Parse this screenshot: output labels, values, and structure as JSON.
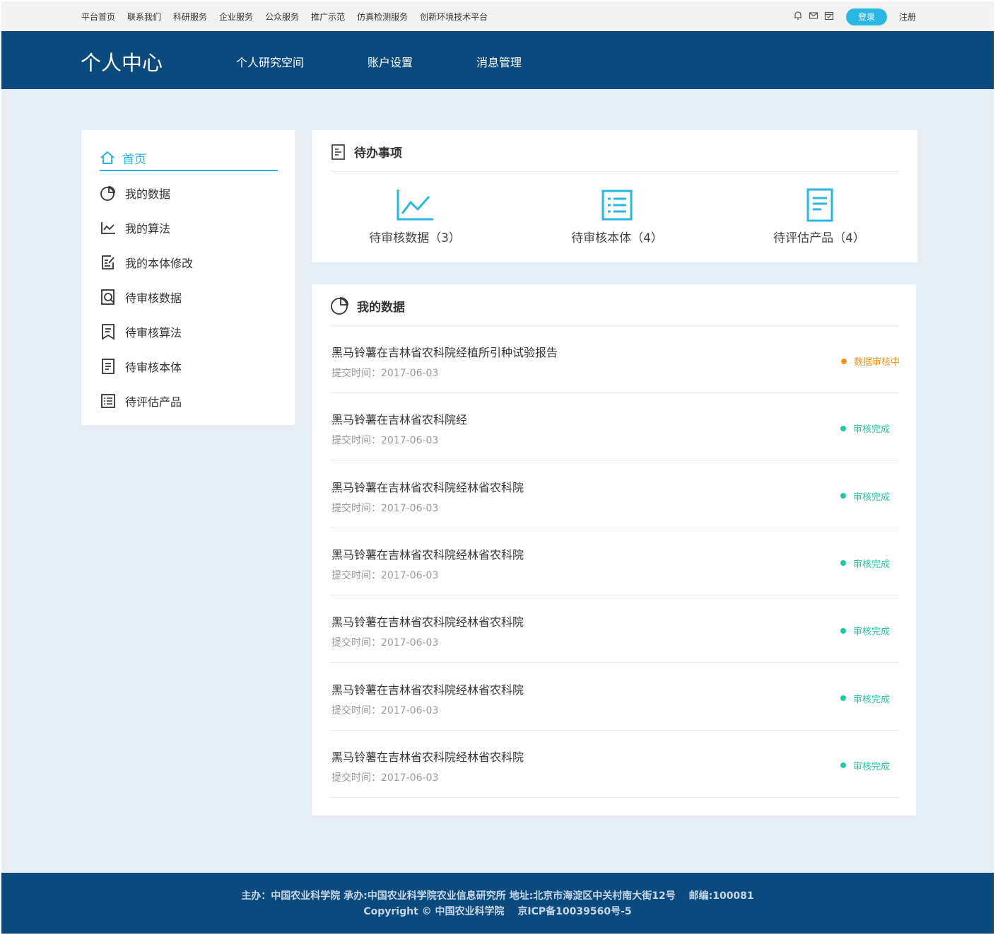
{
  "topbar": {
    "links": [
      "平台首页",
      "联系我们",
      "科研服务",
      "企业服务",
      "公众服务",
      "推广示范",
      "仿真检测服务",
      "创新环境技术平台"
    ],
    "login_label": "登录",
    "register_label": "注册"
  },
  "header": {
    "brand": "个人中心",
    "nav": [
      "个人研究空间",
      "账户设置",
      "消息管理"
    ]
  },
  "sidebar": {
    "home_label": "首页",
    "items": [
      {
        "label": "我的数据",
        "icon": "pie-chart-icon"
      },
      {
        "label": "我的算法",
        "icon": "line-chart-icon"
      },
      {
        "label": "我的本体修改",
        "icon": "edit-doc-icon"
      },
      {
        "label": "待审核数据",
        "icon": "search-doc-icon"
      },
      {
        "label": "待审核算法",
        "icon": "bookmark-doc-icon"
      },
      {
        "label": "待审核本体",
        "icon": "doc-lines-icon"
      },
      {
        "label": "待评估产品",
        "icon": "list-doc-icon"
      }
    ]
  },
  "todo": {
    "title": "待办事项",
    "items": [
      {
        "label": "待审核数据（3）",
        "icon": "line-chart-icon"
      },
      {
        "label": "待审核本体（4）",
        "icon": "list-box-icon"
      },
      {
        "label": "待评估产品（4）",
        "icon": "doc-lines-icon"
      }
    ]
  },
  "mydata": {
    "title": "我的数据",
    "rows": [
      {
        "title": "黑马铃薯在吉林省农科院经植所引种试验报告",
        "time": "提交时间：2017-06-03",
        "status": "数据审核中",
        "status_color": "#f7931e"
      },
      {
        "title": "黑马铃薯在吉林省农科院经",
        "time": "提交时间：2017-06-03",
        "status": "审核完成",
        "status_color": "#1fc9a8"
      },
      {
        "title": "黑马铃薯在吉林省农科院经林省农科院",
        "time": "提交时间：2017-06-03",
        "status": "审核完成",
        "status_color": "#1fc9a8"
      },
      {
        "title": "黑马铃薯在吉林省农科院经林省农科院",
        "time": "提交时间：2017-06-03",
        "status": "审核完成",
        "status_color": "#1fc9a8"
      },
      {
        "title": "黑马铃薯在吉林省农科院经林省农科院",
        "time": "提交时间：2017-06-03",
        "status": "审核完成",
        "status_color": "#1fc9a8"
      },
      {
        "title": "黑马铃薯在吉林省农科院经林省农科院",
        "time": "提交时间：2017-06-03",
        "status": "审核完成",
        "status_color": "#1fc9a8"
      },
      {
        "title": "黑马铃薯在吉林省农科院经林省农科院",
        "time": "提交时间：2017-06-03",
        "status": "审核完成",
        "status_color": "#1fc9a8"
      }
    ]
  },
  "footer": {
    "line1": "主办：中国农业科学院 承办:中国农业科学院农业信息研究所 地址:北京市海淀区中关村南大街12号　 邮编:100081",
    "line2": "Copyright © 中国农业科学院　 京ICP备10039560号-5"
  },
  "colors": {
    "primary": "#0a4a7e",
    "accent": "#29b6e3",
    "status_pending": "#f7931e",
    "status_done": "#1fc9a8"
  }
}
